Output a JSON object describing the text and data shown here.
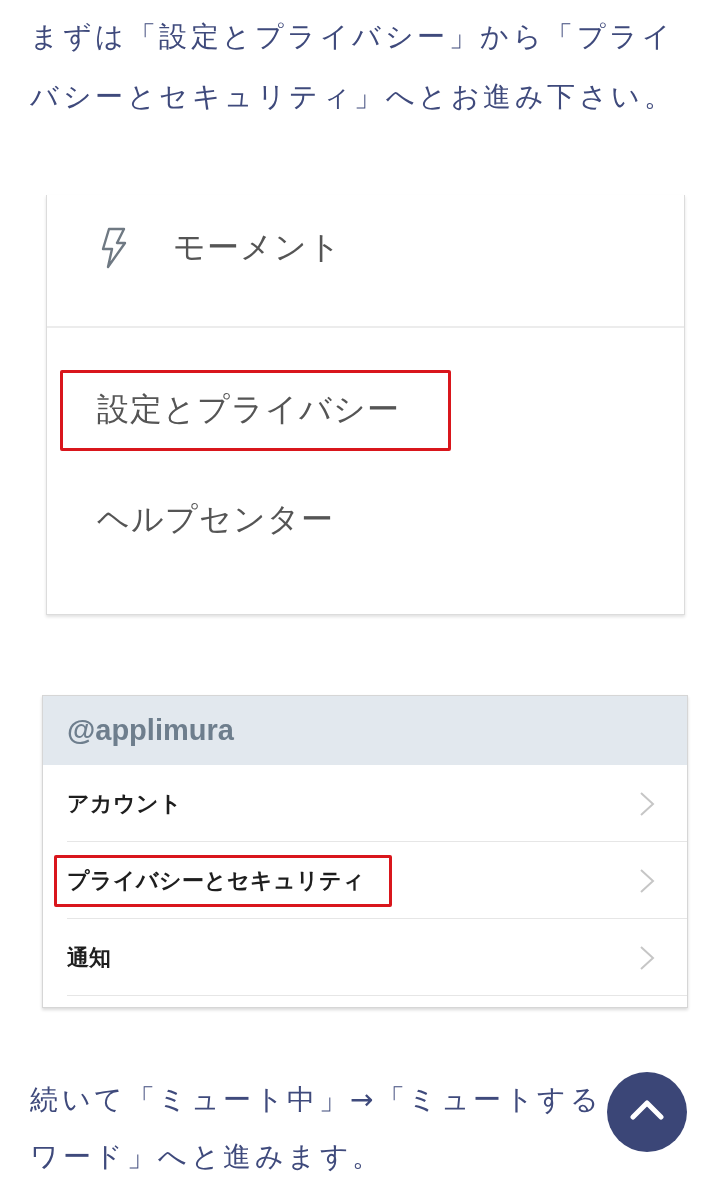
{
  "intro": {
    "text": "まずは「設定とプライバシー」から「プライバシーとセキュリティ」へとお進み下さい。"
  },
  "menu_screenshot": {
    "sections": [
      {
        "items": [
          {
            "kind": "icon",
            "label": "モーメント",
            "highlighted": false
          }
        ]
      },
      {
        "items": [
          {
            "kind": "text",
            "label": "設定とプライバシー",
            "highlighted": true
          },
          {
            "kind": "text",
            "label": "ヘルプセンター",
            "highlighted": false
          }
        ]
      }
    ]
  },
  "settings_screenshot": {
    "account_header": "@applimura",
    "rows": [
      {
        "label": "アカウント",
        "highlighted": false
      },
      {
        "label": "プライバシーとセキュリティ",
        "highlighted": true
      },
      {
        "label": "通知",
        "highlighted": false
      }
    ]
  },
  "next_step": {
    "text": "続いて「ミュート中」→「ミュートするワード」へと進みます。"
  }
}
